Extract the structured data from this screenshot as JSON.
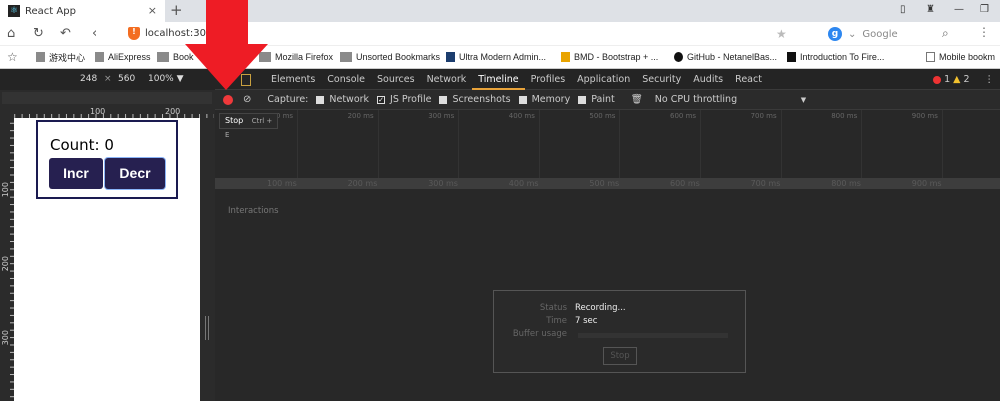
{
  "browser": {
    "tab_title": "React App",
    "tab_close": "×",
    "new_tab": "+",
    "url": "localhost:3000",
    "search_engine": "Google",
    "bookmarks": [
      "游戏中心",
      "AliExpress",
      "Book",
      "Mozilla Firefox",
      "Unsorted Bookmarks",
      "Ultra Modern Admin...",
      "BMD - Bootstrap + ...",
      "GitHub - NetanelBas...",
      "Introduction To Fire..."
    ],
    "mobile_bookmarks": "Mobile bookm"
  },
  "device_toolbar": {
    "width": "248",
    "x": "×",
    "height": "560",
    "zoom": "100% ▼"
  },
  "ruler": {
    "top": [
      "100",
      "200"
    ],
    "left": [
      "100",
      "200",
      "300"
    ]
  },
  "app": {
    "count_label": "Count: 0",
    "incr": "Incr",
    "decr": "Decr"
  },
  "devtools": {
    "tabs": [
      "Elements",
      "Console",
      "Sources",
      "Network",
      "Timeline",
      "Profiles",
      "Application",
      "Security",
      "Audits",
      "React"
    ],
    "active_tab": "Timeline",
    "errors": "1",
    "warnings": "2",
    "capture_label": "Capture:",
    "capture_options": [
      {
        "label": "Network",
        "checked": false
      },
      {
        "label": "JS Profile",
        "checked": true
      },
      {
        "label": "Screenshots",
        "checked": false
      },
      {
        "label": "Memory",
        "checked": false
      },
      {
        "label": "Paint",
        "checked": false
      }
    ],
    "throttling": "No CPU throttling",
    "tooltip": {
      "label": "Stop",
      "shortcut": "Ctrl + E"
    },
    "ticks": [
      "100 ms",
      "200 ms",
      "300 ms",
      "400 ms",
      "500 ms",
      "600 ms",
      "700 ms",
      "800 ms",
      "900 ms"
    ],
    "interactions": "Interactions",
    "dialog": {
      "status_label": "Status",
      "status": "Recording...",
      "time_label": "Time",
      "time": "7 sec",
      "buffer_label": "Buffer usage",
      "buffer_usage": 0,
      "stop": "Stop"
    }
  },
  "annotation": {
    "arrow_color": "#ee1c25"
  }
}
